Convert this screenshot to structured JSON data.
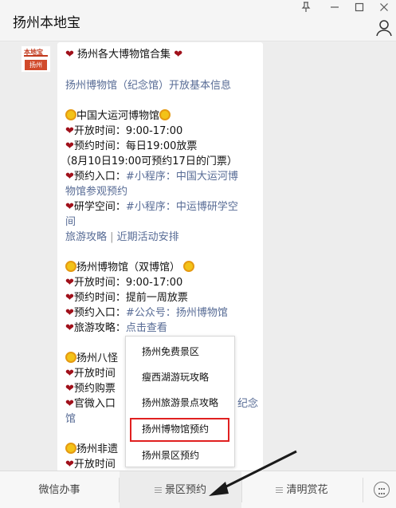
{
  "window": {
    "title": "扬州本地宝",
    "pin_icon": "pin-icon",
    "minimize_icon": "minimize-icon",
    "maximize_icon": "maximize-icon",
    "close_icon": "close-icon",
    "profile_icon": "person-icon"
  },
  "avatar": {
    "brand": "本地宝",
    "tag": "扬州"
  },
  "message": {
    "heading": "扬州各大博物馆合集",
    "intro_link": "扬州博物馆（纪念馆）开放基本信息",
    "sections": [
      {
        "title": "中国大运河博物馆",
        "rows": [
          {
            "label": "开放时间：",
            "value": "9:00-17:00"
          },
          {
            "label": "预约时间：",
            "value": "每日19:00放票"
          },
          {
            "label": "",
            "value": "（8月10日19:00可预约17日的门票）"
          },
          {
            "label": "预约入口：",
            "value": "#小程序：中国大运河博"
          },
          {
            "label": "",
            "value": "物馆参观预约"
          },
          {
            "label": "研学空间：",
            "value": "#小程序：中运博研学空"
          },
          {
            "label": "",
            "value": "间"
          }
        ],
        "links": [
          "旅游攻略",
          "近期活动安排"
        ]
      },
      {
        "title": "扬州博物馆（双博馆）",
        "rows": [
          {
            "label": "开放时间：",
            "value": "9:00-17:00"
          },
          {
            "label": "预约时间：",
            "value": "提前一周放票"
          },
          {
            "label": "预约入口：",
            "value": "#公众号：扬州博物馆"
          },
          {
            "label": "旅游攻略：",
            "value": "点击查看"
          }
        ]
      },
      {
        "title": "扬州八怪",
        "rows": [
          {
            "label": "开放时间",
            "value": ""
          },
          {
            "label": "预约购票",
            "value": ""
          },
          {
            "label": "官微入口",
            "value": "纪念"
          },
          {
            "label": "",
            "value": "馆"
          }
        ]
      },
      {
        "title": "扬州非遗",
        "rows": [
          {
            "label": "开放时间",
            "value": ""
          }
        ]
      }
    ]
  },
  "popup": {
    "items": [
      "扬州免费景区",
      "瘦西湖游玩攻略",
      "扬州旅游景点攻略",
      "扬州博物馆预约",
      "扬州景区预约"
    ],
    "highlighted_index": 3
  },
  "bottom_menu": {
    "items": [
      "微信办事",
      "景区预约",
      "清明赏花"
    ],
    "keyboard_icon": "keyboard-icon"
  },
  "colors": {
    "link": "#576b95",
    "highlight_border": "#e02020",
    "heart": "#a0101a",
    "brand_red": "#c23a1e"
  }
}
